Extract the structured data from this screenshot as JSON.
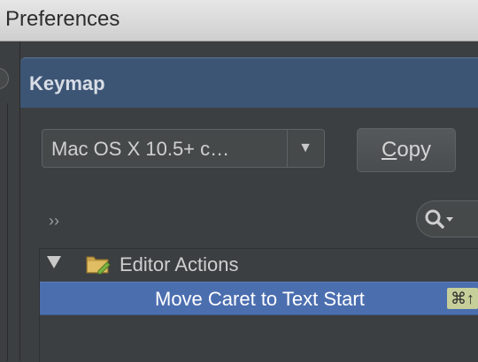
{
  "window": {
    "title": "Preferences"
  },
  "panel": {
    "title": "Keymap"
  },
  "keymap_select": {
    "value": "Mac OS X 10.5+ c…",
    "arrow_icon": "dropdown-arrow-icon"
  },
  "copy_button": {
    "mnemonic": "C",
    "rest": "opy"
  },
  "toolbar": {
    "expand_label": "››"
  },
  "tree": {
    "group": {
      "label": "Editor Actions",
      "icon": "folder-edit-icon"
    },
    "selected_action": {
      "label": "Move Caret to Text Start",
      "shortcut": "⌘↑"
    }
  },
  "colors": {
    "header": "#3d5575",
    "selection": "#4b6eaf",
    "shortcut_badge": "#c6cf9a"
  }
}
